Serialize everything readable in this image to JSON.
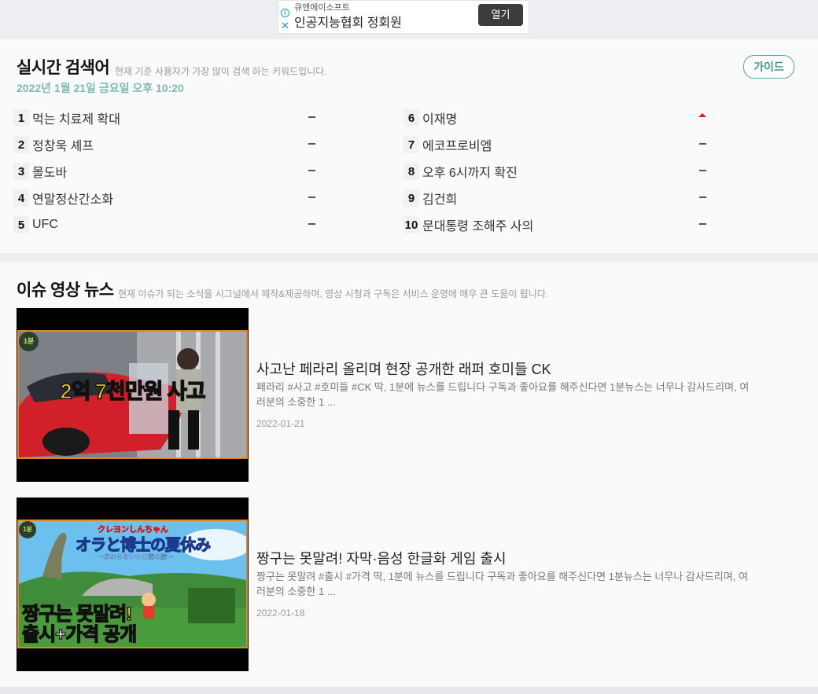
{
  "ad": {
    "sponsor": "큐앤에이소프트",
    "title": "인공지능협회 정회원",
    "button": "열기",
    "info_icon": "i",
    "close_icon": "✕"
  },
  "trending": {
    "title": "실시간 검색어",
    "subtitle": "현재 기준 사용자가 가장 많이 검색 하는 키워드입니다.",
    "datetime": "2022년 1월 21일 금요일 오후 10:20",
    "guide_label": "가이드",
    "keywords": [
      {
        "rank": "1",
        "text": "먹는 치료제 확대",
        "trend": "same"
      },
      {
        "rank": "2",
        "text": "정창욱 셰프",
        "trend": "same"
      },
      {
        "rank": "3",
        "text": "몰도바",
        "trend": "same"
      },
      {
        "rank": "4",
        "text": "연말정산간소화",
        "trend": "same"
      },
      {
        "rank": "5",
        "text": "UFC",
        "trend": "same"
      },
      {
        "rank": "6",
        "text": "이재명",
        "trend": "up"
      },
      {
        "rank": "7",
        "text": "에코프로비엠",
        "trend": "same"
      },
      {
        "rank": "8",
        "text": "오후 6시까지 확진",
        "trend": "same"
      },
      {
        "rank": "9",
        "text": "김건희",
        "trend": "same"
      },
      {
        "rank": "10",
        "text": "문대통령 조해주 사의",
        "trend": "same"
      }
    ],
    "colors": {
      "accent": "#4ba99c",
      "date": "#7bbbb4",
      "up": "#e21b1b"
    }
  },
  "news": {
    "title": "이슈 영상 뉴스",
    "subtitle": "현재 이슈가 되는 소식을 시그널에서 제작&제공하며, 영상 시청과 구독은 서비스 운영에 매우 큰 도움이 됩니다.",
    "items": [
      {
        "title": "사고난 페라리 올리며 현장 공개한 래퍼 호미들 CK",
        "desc": "페라리 #사고 #호미들 #CK 딱, 1분에 뉴스를 드립니다 구독과 좋아요를 해주신다면 1분뉴스는 너무나 감사드리며, 여러분의 소중한 1 ...",
        "date": "2022-01-21",
        "thumb_badge": "1분",
        "thumb_caption": "2억 7천만원 사고"
      },
      {
        "title": "짱구는 못말려! 자막·음성 한글화 게임 출시",
        "desc": "짱구는 못말려 #출시 #가격 딱, 1분에 뉴스를 드립니다 구독과 좋아요를 해주신다면 1분뉴스는 너무나 감사드리며, 여러분의 소중한 1 ...",
        "date": "2022-01-18",
        "thumb_badge": "1분",
        "thumb_top_jp": "クレヨンしんちゃん",
        "thumb_logo_jp": "オラと博士の夏休み",
        "thumb_sub_jp": "～おわらない七日間の旅～",
        "thumb_caption_line1": "짱구는 못말려!",
        "thumb_caption_line2": "출시+가격 공개"
      }
    ]
  }
}
